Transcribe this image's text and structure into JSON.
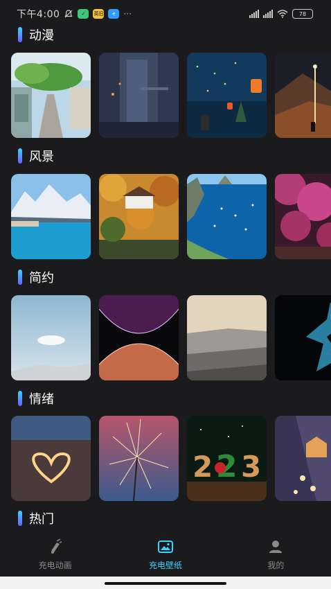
{
  "status_bar": {
    "time": "下午4:00",
    "app_badge_text": "英旧",
    "battery": "78"
  },
  "sections": [
    {
      "title": "动漫"
    },
    {
      "title": "风景"
    },
    {
      "title": "简约"
    },
    {
      "title": "情绪"
    },
    {
      "title": "热门"
    }
  ],
  "tabs": [
    {
      "label": "充电动画",
      "icon": "charging-animation-icon"
    },
    {
      "label": "充电壁纸",
      "icon": "wallpaper-icon"
    },
    {
      "label": "我的",
      "icon": "profile-icon"
    }
  ],
  "colors": {
    "background": "#1b1b1d",
    "accent": "#3fd1ff",
    "accent_gradient_end": "#6a63ff",
    "tab_inactive": "#8a8a8a"
  }
}
